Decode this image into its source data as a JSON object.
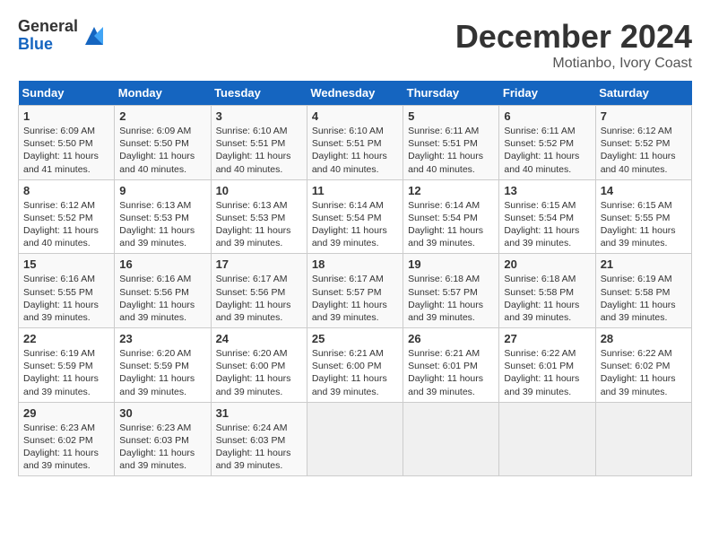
{
  "logo": {
    "general": "General",
    "blue": "Blue"
  },
  "title": "December 2024",
  "location": "Motianbo, Ivory Coast",
  "days_of_week": [
    "Sunday",
    "Monday",
    "Tuesday",
    "Wednesday",
    "Thursday",
    "Friday",
    "Saturday"
  ],
  "weeks": [
    [
      {
        "day": "1",
        "sunrise": "6:09 AM",
        "sunset": "5:50 PM",
        "daylight": "11 hours and 41 minutes."
      },
      {
        "day": "2",
        "sunrise": "6:09 AM",
        "sunset": "5:50 PM",
        "daylight": "11 hours and 40 minutes."
      },
      {
        "day": "3",
        "sunrise": "6:10 AM",
        "sunset": "5:51 PM",
        "daylight": "11 hours and 40 minutes."
      },
      {
        "day": "4",
        "sunrise": "6:10 AM",
        "sunset": "5:51 PM",
        "daylight": "11 hours and 40 minutes."
      },
      {
        "day": "5",
        "sunrise": "6:11 AM",
        "sunset": "5:51 PM",
        "daylight": "11 hours and 40 minutes."
      },
      {
        "day": "6",
        "sunrise": "6:11 AM",
        "sunset": "5:52 PM",
        "daylight": "11 hours and 40 minutes."
      },
      {
        "day": "7",
        "sunrise": "6:12 AM",
        "sunset": "5:52 PM",
        "daylight": "11 hours and 40 minutes."
      }
    ],
    [
      {
        "day": "8",
        "sunrise": "6:12 AM",
        "sunset": "5:52 PM",
        "daylight": "11 hours and 40 minutes."
      },
      {
        "day": "9",
        "sunrise": "6:13 AM",
        "sunset": "5:53 PM",
        "daylight": "11 hours and 39 minutes."
      },
      {
        "day": "10",
        "sunrise": "6:13 AM",
        "sunset": "5:53 PM",
        "daylight": "11 hours and 39 minutes."
      },
      {
        "day": "11",
        "sunrise": "6:14 AM",
        "sunset": "5:54 PM",
        "daylight": "11 hours and 39 minutes."
      },
      {
        "day": "12",
        "sunrise": "6:14 AM",
        "sunset": "5:54 PM",
        "daylight": "11 hours and 39 minutes."
      },
      {
        "day": "13",
        "sunrise": "6:15 AM",
        "sunset": "5:54 PM",
        "daylight": "11 hours and 39 minutes."
      },
      {
        "day": "14",
        "sunrise": "6:15 AM",
        "sunset": "5:55 PM",
        "daylight": "11 hours and 39 minutes."
      }
    ],
    [
      {
        "day": "15",
        "sunrise": "6:16 AM",
        "sunset": "5:55 PM",
        "daylight": "11 hours and 39 minutes."
      },
      {
        "day": "16",
        "sunrise": "6:16 AM",
        "sunset": "5:56 PM",
        "daylight": "11 hours and 39 minutes."
      },
      {
        "day": "17",
        "sunrise": "6:17 AM",
        "sunset": "5:56 PM",
        "daylight": "11 hours and 39 minutes."
      },
      {
        "day": "18",
        "sunrise": "6:17 AM",
        "sunset": "5:57 PM",
        "daylight": "11 hours and 39 minutes."
      },
      {
        "day": "19",
        "sunrise": "6:18 AM",
        "sunset": "5:57 PM",
        "daylight": "11 hours and 39 minutes."
      },
      {
        "day": "20",
        "sunrise": "6:18 AM",
        "sunset": "5:58 PM",
        "daylight": "11 hours and 39 minutes."
      },
      {
        "day": "21",
        "sunrise": "6:19 AM",
        "sunset": "5:58 PM",
        "daylight": "11 hours and 39 minutes."
      }
    ],
    [
      {
        "day": "22",
        "sunrise": "6:19 AM",
        "sunset": "5:59 PM",
        "daylight": "11 hours and 39 minutes."
      },
      {
        "day": "23",
        "sunrise": "6:20 AM",
        "sunset": "5:59 PM",
        "daylight": "11 hours and 39 minutes."
      },
      {
        "day": "24",
        "sunrise": "6:20 AM",
        "sunset": "6:00 PM",
        "daylight": "11 hours and 39 minutes."
      },
      {
        "day": "25",
        "sunrise": "6:21 AM",
        "sunset": "6:00 PM",
        "daylight": "11 hours and 39 minutes."
      },
      {
        "day": "26",
        "sunrise": "6:21 AM",
        "sunset": "6:01 PM",
        "daylight": "11 hours and 39 minutes."
      },
      {
        "day": "27",
        "sunrise": "6:22 AM",
        "sunset": "6:01 PM",
        "daylight": "11 hours and 39 minutes."
      },
      {
        "day": "28",
        "sunrise": "6:22 AM",
        "sunset": "6:02 PM",
        "daylight": "11 hours and 39 minutes."
      }
    ],
    [
      {
        "day": "29",
        "sunrise": "6:23 AM",
        "sunset": "6:02 PM",
        "daylight": "11 hours and 39 minutes."
      },
      {
        "day": "30",
        "sunrise": "6:23 AM",
        "sunset": "6:03 PM",
        "daylight": "11 hours and 39 minutes."
      },
      {
        "day": "31",
        "sunrise": "6:24 AM",
        "sunset": "6:03 PM",
        "daylight": "11 hours and 39 minutes."
      },
      null,
      null,
      null,
      null
    ]
  ]
}
